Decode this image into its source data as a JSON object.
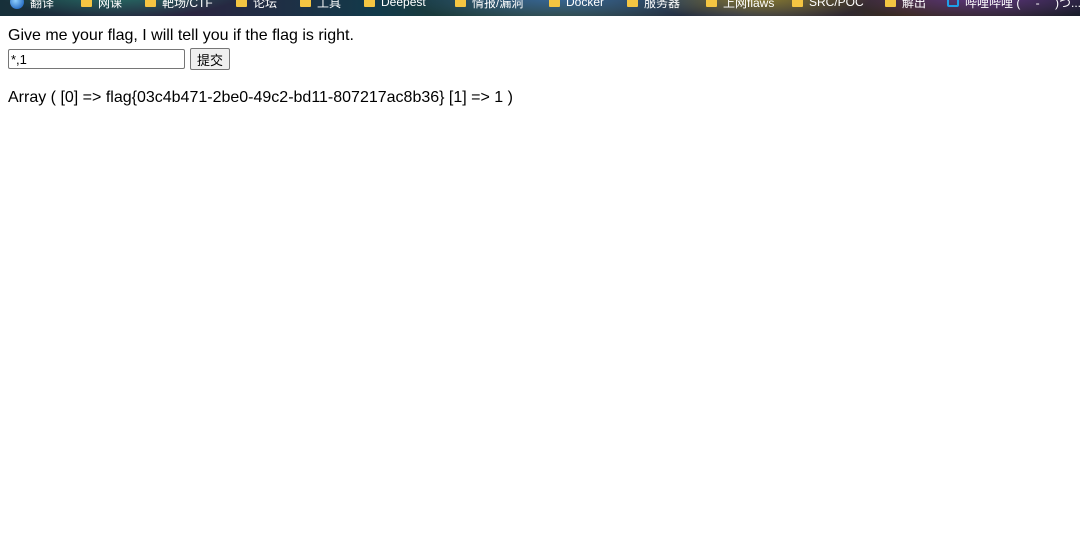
{
  "bookmarks": [
    {
      "label": "翻译",
      "icon": "globe-icon"
    },
    {
      "label": "网课",
      "icon": "folder-icon"
    },
    {
      "label": "靶场/CTF",
      "icon": "folder-icon"
    },
    {
      "label": "论坛",
      "icon": "folder-icon"
    },
    {
      "label": "工具",
      "icon": "folder-icon"
    },
    {
      "label": "Deepest",
      "icon": "folder-icon"
    },
    {
      "label": "情报/漏洞",
      "icon": "folder-icon"
    },
    {
      "label": "Docker",
      "icon": "folder-icon"
    },
    {
      "label": "服务器",
      "icon": "folder-icon"
    },
    {
      "label": "上网flaws",
      "icon": "folder-icon"
    },
    {
      "label": "SRC/POC",
      "icon": "folder-icon"
    },
    {
      "label": "解出",
      "icon": "folder-icon"
    },
    {
      "label": "哔哩哔哩 ( ゜- ゜)つ...",
      "icon": "bilibili-icon"
    }
  ],
  "page": {
    "prompt": "Give me your flag, I will tell you if the flag is right.",
    "input_value": "*,1",
    "submit_label": "提交",
    "result": "Array ( [0] => flag{03c4b471-2be0-49c2-bd11-807217ac8b36} [1] => 1 )"
  }
}
